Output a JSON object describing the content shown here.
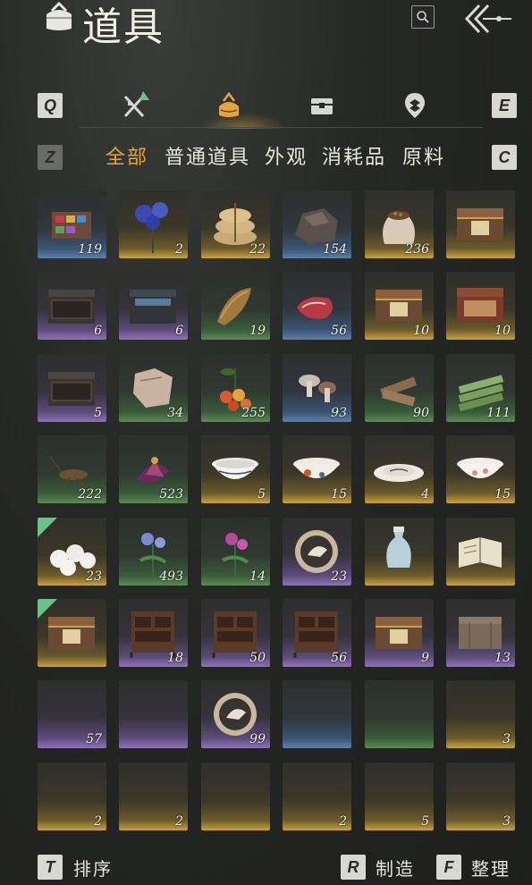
{
  "header": {
    "title": "道具",
    "search_icon": "search-icon",
    "back_icon": "back-arrow-icon"
  },
  "tabs": {
    "left_key": "Q",
    "right_key": "E",
    "items": [
      {
        "name": "weapons",
        "icon": "crossed-swords-icon"
      },
      {
        "name": "items",
        "icon": "bundle-icon",
        "active": true
      },
      {
        "name": "chest",
        "icon": "chest-icon"
      },
      {
        "name": "location",
        "icon": "map-pin-icon"
      }
    ]
  },
  "subtabs": {
    "left_key": "Z",
    "right_key": "C",
    "items": [
      "全部",
      "普通道具",
      "外观",
      "消耗品",
      "原料"
    ],
    "active_index": 0
  },
  "inventory": [
    {
      "item": "dye-box",
      "count": "119",
      "rarity": "blue"
    },
    {
      "item": "blue-flower",
      "count": "2",
      "rarity": "gold"
    },
    {
      "item": "rice-bags",
      "count": "22",
      "rarity": "gold"
    },
    {
      "item": "ore",
      "count": "154",
      "rarity": "blue"
    },
    {
      "item": "grain-sack",
      "count": "236",
      "rarity": "gold"
    },
    {
      "item": "gold-chest",
      "count": "",
      "rarity": "gold"
    },
    {
      "item": "dark-chest",
      "count": "6",
      "rarity": "purple"
    },
    {
      "item": "gem-chest",
      "count": "6",
      "rarity": "purple"
    },
    {
      "item": "straw",
      "count": "19",
      "rarity": "green"
    },
    {
      "item": "meat",
      "count": "56",
      "rarity": "blue"
    },
    {
      "item": "gold-chest",
      "count": "10",
      "rarity": "gold"
    },
    {
      "item": "red-chest",
      "count": "10",
      "rarity": "gold"
    },
    {
      "item": "dark-chest",
      "count": "5",
      "rarity": "purple"
    },
    {
      "item": "hide",
      "count": "34",
      "rarity": "green"
    },
    {
      "item": "berries",
      "count": "255",
      "rarity": "green"
    },
    {
      "item": "mushrooms",
      "count": "93",
      "rarity": "blue"
    },
    {
      "item": "wood",
      "count": "90",
      "rarity": "green"
    },
    {
      "item": "bamboo",
      "count": "111",
      "rarity": "green"
    },
    {
      "item": "cricket",
      "count": "222",
      "rarity": "green"
    },
    {
      "item": "purple-flower",
      "count": "523",
      "rarity": "green"
    },
    {
      "item": "white-bowl",
      "count": "5",
      "rarity": "gold"
    },
    {
      "item": "painted-bowl",
      "count": "15",
      "rarity": "gold"
    },
    {
      "item": "plate",
      "count": "4",
      "rarity": "gold"
    },
    {
      "item": "pink-bowl",
      "count": "15",
      "rarity": "gold"
    },
    {
      "item": "buns",
      "count": "23",
      "rarity": "gold",
      "badge": true
    },
    {
      "item": "blue-herb",
      "count": "493",
      "rarity": "green"
    },
    {
      "item": "pink-herb",
      "count": "14",
      "rarity": "green"
    },
    {
      "item": "bird-token",
      "count": "23",
      "rarity": "purple"
    },
    {
      "item": "vase",
      "count": "",
      "rarity": "gold"
    },
    {
      "item": "book",
      "count": "",
      "rarity": "gold"
    },
    {
      "item": "gold-chest",
      "count": "",
      "rarity": "gold",
      "badge": true
    },
    {
      "item": "cabinet",
      "count": "18",
      "rarity": "purple"
    },
    {
      "item": "cabinet",
      "count": "50",
      "rarity": "purple"
    },
    {
      "item": "cabinet",
      "count": "56",
      "rarity": "purple"
    },
    {
      "item": "gold-chest",
      "count": "9",
      "rarity": "purple"
    },
    {
      "item": "box",
      "count": "13",
      "rarity": "purple"
    },
    {
      "item": "",
      "count": "57",
      "rarity": "purple"
    },
    {
      "item": "",
      "count": "",
      "rarity": "purple"
    },
    {
      "item": "bird-token",
      "count": "99",
      "rarity": "purple"
    },
    {
      "item": "",
      "count": "",
      "rarity": "blue"
    },
    {
      "item": "",
      "count": "",
      "rarity": "green"
    },
    {
      "item": "",
      "count": "3",
      "rarity": "gold"
    },
    {
      "item": "",
      "count": "2",
      "rarity": "gold"
    },
    {
      "item": "",
      "count": "2",
      "rarity": "gold"
    },
    {
      "item": "",
      "count": "",
      "rarity": "gold"
    },
    {
      "item": "",
      "count": "2",
      "rarity": "gold"
    },
    {
      "item": "",
      "count": "5",
      "rarity": "gold"
    },
    {
      "item": "",
      "count": "3",
      "rarity": "gold"
    }
  ],
  "footer": {
    "sort": {
      "key": "T",
      "label": "排序"
    },
    "craft": {
      "key": "R",
      "label": "制造"
    },
    "organize": {
      "key": "F",
      "label": "整理"
    }
  },
  "colors": {
    "accent": "#e7a540",
    "gold": "#c9a13e",
    "purple": "#8d72b8",
    "blue": "#5c7fa8",
    "green": "#5b8a55"
  }
}
